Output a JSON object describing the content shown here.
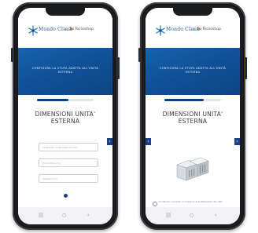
{
  "phones": [
    {
      "status": {
        "time": ""
      },
      "brand": {
        "name_1": "Mondo Clima",
        "sub_1": "",
        "separator": "+",
        "name_2_prefix": "Tu",
        "name_2": "Tecnoshop"
      },
      "banner": {
        "text": "CONFIGURA LA STUFA ADATTA ALL'UNITÀ ESTERNA"
      },
      "progress": {
        "fraction": 0.55
      },
      "title": "DIMENSIONI UNITA' ESTERNA",
      "nav": {
        "next_icon": "chevron-right-icon",
        "next_glyph": "›"
      },
      "fields": [
        {
          "placeholder": "Larghezza unità esterna (cm)"
        },
        {
          "placeholder": "Profondità (cm)"
        },
        {
          "placeholder": "Altezza (cm)"
        }
      ],
      "navbar": {
        "recents": "|||",
        "home": "○",
        "back": "‹"
      }
    },
    {
      "status": {
        "time": ""
      },
      "brand": {
        "name_1": "Mondo Clima",
        "sub_1": "",
        "separator": "+",
        "name_2_prefix": "Tu",
        "name_2": "Tecnoshop"
      },
      "banner": {
        "text": "CONFIGURA LA STUFA ADATTA ALL'UNITÀ ESTERNA"
      },
      "progress": {
        "fraction": 0.7
      },
      "title": "DIMENSIONI UNITA' ESTERNA",
      "nav": {
        "prev_glyph": "‹",
        "next_glyph": "›"
      },
      "consent": "Confermo e presto il consenso al trattamento dei dati",
      "navbar": {
        "recents": "|||",
        "home": "○",
        "back": "‹"
      }
    }
  ],
  "colors": {
    "banner": "#1663ad",
    "accent": "#1d3f8a",
    "progress": "#0f3f7f"
  }
}
